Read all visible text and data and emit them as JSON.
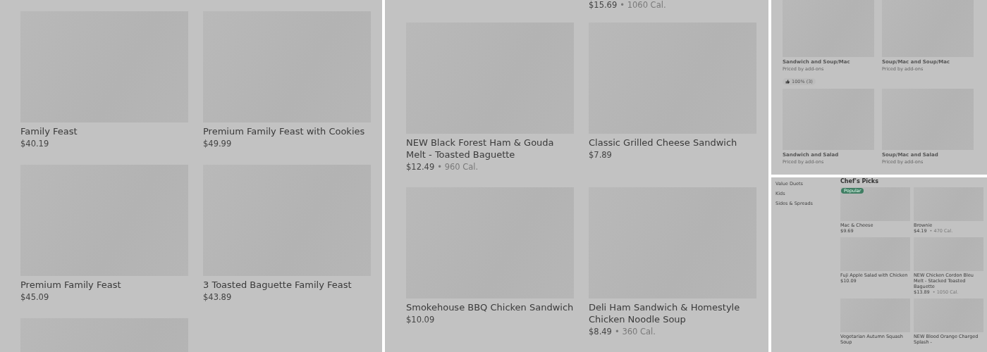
{
  "panels": [
    {
      "items": [
        {
          "kind": "item",
          "name": "Family Feast",
          "price": "$40.19"
        },
        {
          "kind": "item",
          "name": "Premium Family Feast with Cookies",
          "price": "$49.99"
        },
        {
          "kind": "item",
          "name": "Premium Family Feast",
          "price": "$45.09"
        },
        {
          "kind": "item",
          "name": "3 Toasted Baguette Family Feast",
          "price": "$43.89"
        },
        {
          "kind": "image_only"
        }
      ]
    },
    {
      "items": [
        {
          "kind": "empty"
        },
        {
          "kind": "price_only",
          "price": "$15.69",
          "calories": "• 1060 Cal."
        },
        {
          "kind": "item",
          "name": "NEW Black Forest Ham & Gouda Melt - Toasted Baguette",
          "price": "$12.49",
          "calories": "• 960 Cal."
        },
        {
          "kind": "item",
          "name": "Classic Grilled Cheese Sandwich",
          "price": "$7.89"
        },
        {
          "kind": "item",
          "name": "Smokehouse BBQ Chicken Sandwich",
          "price": "$10.09"
        },
        {
          "kind": "item",
          "name": "Deli Ham Sandwich & Homestyle Chicken Noodle Soup",
          "price": "$8.49",
          "calories": "• 360 Cal."
        }
      ]
    },
    {
      "items": [
        {
          "kind": "item",
          "name": "Sandwich and Soup/Mac",
          "price": "Priced by add-ons",
          "rating": "100% (3)"
        },
        {
          "kind": "item",
          "name": "Soup/Mac and Soup/Mac",
          "price": "Priced by add-ons"
        },
        {
          "kind": "item",
          "name": "Sandwich and Salad",
          "price": "Priced by add-ons"
        },
        {
          "kind": "item",
          "name": "Soup/Mac and Salad",
          "price": "Priced by add-ons"
        }
      ]
    },
    {
      "sidebar": [
        "Value Duets",
        "Kids",
        "Sides & Spreads"
      ],
      "heading": "Chef's Picks",
      "items": [
        {
          "kind": "item",
          "name": "Mac & Cheese",
          "price": "$9.69",
          "badge": "Popular"
        },
        {
          "kind": "item",
          "name": "Brownie",
          "price": "$4.19",
          "calories": "• 470 Cal."
        },
        {
          "kind": "item",
          "name": "Fuji Apple Salad with Chicken",
          "price": "$10.09"
        },
        {
          "kind": "item",
          "name": "NEW Chicken Cordon Bleu Melt - Stacked Toasted Baguette",
          "price": "$13.89",
          "calories": "• 1050 Cal."
        },
        {
          "kind": "item",
          "name": "Vegetarian Autumn Squash Soup"
        },
        {
          "kind": "item",
          "name": "NEW Blood Orange Charged Splash -"
        }
      ]
    }
  ]
}
